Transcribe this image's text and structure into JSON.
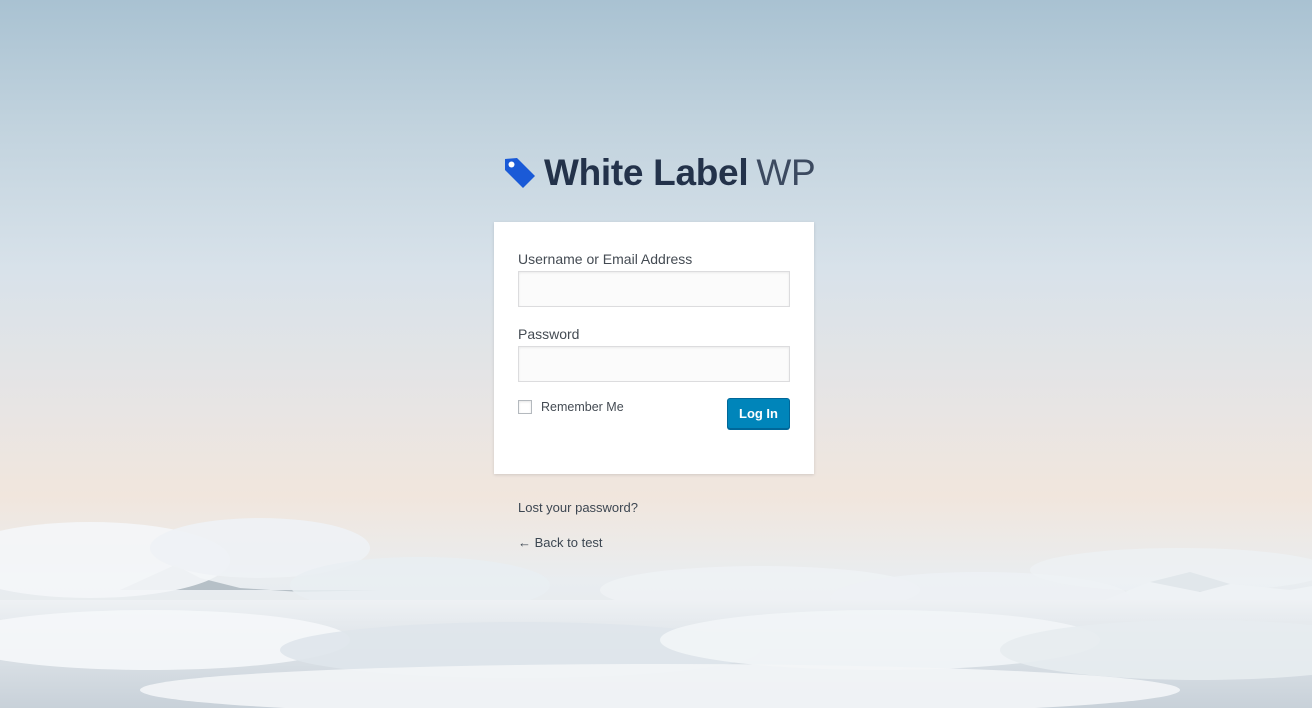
{
  "logo": {
    "name_bold": "White Label",
    "name_light": "WP",
    "icon": "tag-icon"
  },
  "form": {
    "username_label": "Username or Email Address",
    "username_value": "",
    "password_label": "Password",
    "password_value": "",
    "remember_label": "Remember Me",
    "remember_checked": false,
    "submit_label": "Log In"
  },
  "links": {
    "lost_password": "Lost your password?",
    "back_to_site": "← Back to test"
  },
  "colors": {
    "accent": "#0085ba",
    "logo_icon": "#1a5ad7",
    "logo_text": "#23324a"
  }
}
